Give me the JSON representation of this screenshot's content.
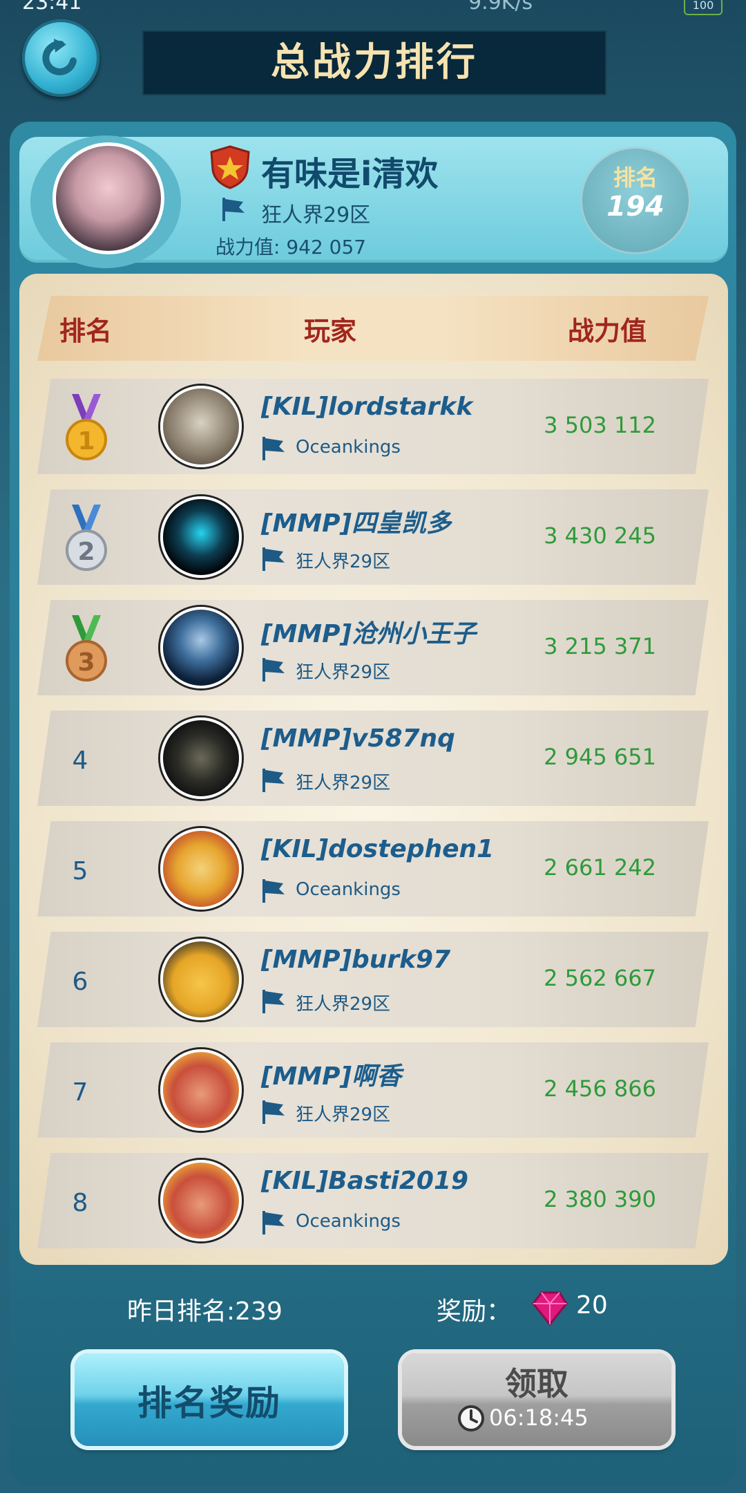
{
  "status_bar": {
    "time": "23:41",
    "net_speed": "9.9K/s",
    "battery": "100"
  },
  "header": {
    "title": "总战力排行"
  },
  "me": {
    "name": "有味是i清欢",
    "server": "狂人界29区",
    "power_label": "战力值: 942 057",
    "rank_label": "排名",
    "rank_value": "194"
  },
  "table": {
    "columns": [
      "排名",
      "玩家",
      "战力值"
    ],
    "rows": [
      {
        "rank": "1",
        "name": "[KIL]lordstarkk",
        "server": "Oceankings",
        "power": "3 503 112"
      },
      {
        "rank": "2",
        "name": "[MMP]四皇凯多",
        "server": "狂人界29区",
        "power": "3 430 245"
      },
      {
        "rank": "3",
        "name": "[MMP]沧州小王子",
        "server": "狂人界29区",
        "power": "3 215 371"
      },
      {
        "rank": "4",
        "name": "[MMP]v587nq",
        "server": "狂人界29区",
        "power": "2 945 651"
      },
      {
        "rank": "5",
        "name": "[KIL]dostephen1",
        "server": "Oceankings",
        "power": "2 661 242"
      },
      {
        "rank": "6",
        "name": "[MMP]burk97",
        "server": "狂人界29区",
        "power": "2 562 667"
      },
      {
        "rank": "7",
        "name": "[MMP]啊香",
        "server": "狂人界29区",
        "power": "2 456 866"
      },
      {
        "rank": "8",
        "name": "[KIL]Basti2019",
        "server": "Oceankings",
        "power": "2 380 390"
      }
    ]
  },
  "footer": {
    "yesterday_rank": "昨日排名:239",
    "reward_label": "奖励：",
    "reward_amount": "20",
    "rank_reward_button": "排名奖励",
    "claim_button": "领取",
    "countdown": "06:18:45"
  },
  "icons": {
    "back": "back-arrow-icon",
    "shield": "shield-star-icon",
    "flag": "flag-icon",
    "gem": "gem-icon",
    "clock": "clock-icon"
  },
  "colors": {
    "accent_red": "#a0261d",
    "power_green": "#2e9a3a",
    "name_blue": "#1c5d8c"
  }
}
